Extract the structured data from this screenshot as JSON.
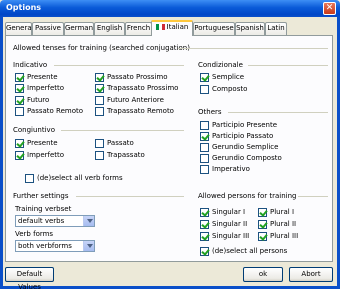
{
  "window": {
    "title": "Options"
  },
  "tabs": [
    {
      "label": "General"
    },
    {
      "label": "Passive"
    },
    {
      "label": "German"
    },
    {
      "label": "English"
    },
    {
      "label": "French"
    },
    {
      "label": "Italian"
    },
    {
      "label": "Portuguese"
    },
    {
      "label": "Spanish"
    },
    {
      "label": "Latin"
    }
  ],
  "allowed_tenses": {
    "heading": "Allowed tenses for training (searched conjugation)"
  },
  "indicativo": {
    "heading": "Indicativo",
    "items": [
      {
        "label": "Presente",
        "checked": true
      },
      {
        "label": "Imperfetto",
        "checked": true
      },
      {
        "label": "Futuro",
        "checked": true
      },
      {
        "label": "Passato Remoto",
        "checked": false
      },
      {
        "label": "Passato Prossimo",
        "checked": true
      },
      {
        "label": "Trapassato Prossimo",
        "checked": true
      },
      {
        "label": "Futuro Anteriore",
        "checked": false
      },
      {
        "label": "Trapassato Remoto",
        "checked": false
      }
    ]
  },
  "congiuntivo": {
    "heading": "Congiuntivo",
    "items": [
      {
        "label": "Presente",
        "checked": true
      },
      {
        "label": "Imperfetto",
        "checked": true
      },
      {
        "label": "Passato",
        "checked": false
      },
      {
        "label": "Trapassato",
        "checked": false
      }
    ],
    "select_all": "(de)select all verb forms"
  },
  "condizionale": {
    "heading": "Condizionale",
    "items": [
      {
        "label": "Semplice",
        "checked": true
      },
      {
        "label": "Composto",
        "checked": false
      }
    ]
  },
  "others": {
    "heading": "Others",
    "items": [
      {
        "label": "Participio Presente",
        "checked": false
      },
      {
        "label": "Participio Passato",
        "checked": true
      },
      {
        "label": "Gerundio Semplice",
        "checked": false
      },
      {
        "label": "Gerundio Composto",
        "checked": false
      },
      {
        "label": "Imperativo",
        "checked": false
      }
    ]
  },
  "further": {
    "heading": "Further settings",
    "training_verbset_label": "Training verbset",
    "training_verbset_value": "default verbs",
    "verb_forms_label": "Verb forms",
    "verb_forms_value": "both verbforms"
  },
  "persons": {
    "heading": "Allowed persons for training",
    "items": [
      {
        "label": "Singular I",
        "checked": true
      },
      {
        "label": "Singular II",
        "checked": true
      },
      {
        "label": "Singular III",
        "checked": true
      },
      {
        "label": "Plural I",
        "checked": true
      },
      {
        "label": "Plural II",
        "checked": true
      },
      {
        "label": "Plural III",
        "checked": true
      }
    ],
    "select_all": "(de)select all persons",
    "select_all_checked": true
  },
  "buttons": {
    "default_values": "Default Values",
    "ok": "ok",
    "abort": "Abort"
  },
  "colors": {
    "title_bar": "#0a5ad8",
    "tab_highlight": "#ffc83c",
    "check": "#21a121"
  }
}
